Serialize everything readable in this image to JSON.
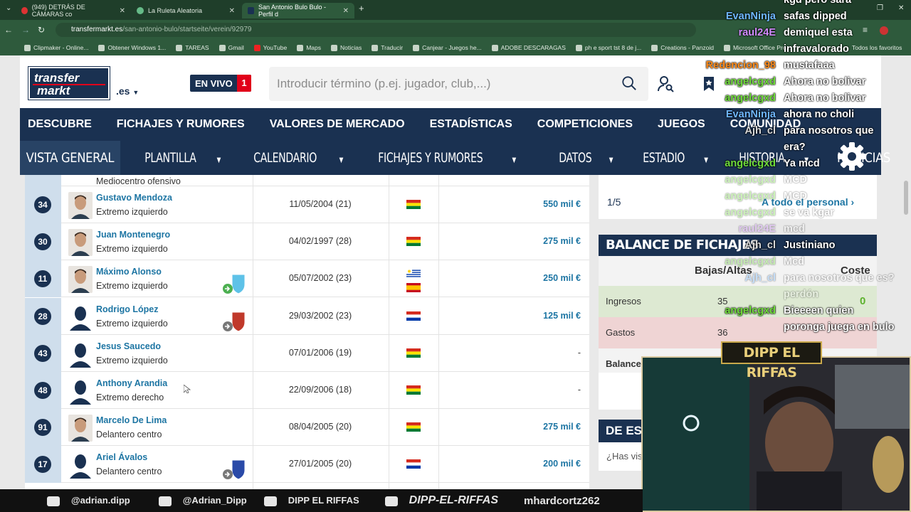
{
  "browser": {
    "tabs": [
      {
        "label": "(949) DETRÁS DE CÁMARAS co",
        "active": false
      },
      {
        "label": "La Ruleta Aleatoria",
        "active": false
      },
      {
        "label": "San Antonio Bulo Bulo - Perfil d",
        "active": true
      }
    ],
    "new_tab": "+",
    "url_host": "transfermarkt.es",
    "url_path": "/san-antonio-bulo/startseite/verein/92979",
    "bookmarks": [
      "Clipmaker - Online...",
      "Obtener Windows 1...",
      "TAREAS",
      "Gmail",
      "YouTube",
      "Maps",
      "Noticias",
      "Traducir",
      "Canjear - Juegos he...",
      "ADOBE DESCARAGAS",
      "ph e sport tst 8 de j...",
      "Creations - Panzoid",
      "Microsoft Office Pro..."
    ],
    "all_bookmarks": "Todos los favoritos"
  },
  "site": {
    "logo_top": "transfer",
    "logo_bottom": "markt",
    "domain": ".es",
    "live_label": "EN VIVO",
    "live_count": "1",
    "search_placeholder": "Introducir término (p.ej. jugador, club,...)",
    "main_nav": [
      "DESCUBRE",
      "FICHAJES Y RUMORES",
      "VALORES DE MERCADO",
      "ESTADÍSTICAS",
      "COMPETICIONES",
      "JUEGOS",
      "COMUNIDAD"
    ],
    "sub_nav": [
      "VISTA GENERAL",
      "PLANTILLA",
      "CALENDARIO",
      "FICHAJES Y RUMORES",
      "DATOS",
      "ESTADIO",
      "HISTORIA",
      "NOTICIAS"
    ]
  },
  "squad": {
    "partial_row_position": "Mediocentro ofensivo",
    "rows": [
      {
        "number": "34",
        "name": "Gustavo Mendoza",
        "position": "Extremo izquierdo",
        "dob": "11/05/2004 (21)",
        "flags": [
          "bol"
        ],
        "value": "550 mil €"
      },
      {
        "number": "30",
        "name": "Juan Montenegro",
        "position": "Extremo izquierdo",
        "dob": "04/02/1997 (28)",
        "flags": [
          "bol"
        ],
        "value": "275 mil €"
      },
      {
        "number": "11",
        "name": "Máximo Alonso",
        "position": "Extremo izquierdo",
        "dob": "05/07/2002 (23)",
        "flags": [
          "uru",
          "esp"
        ],
        "value": "250 mil €"
      },
      {
        "number": "28",
        "name": "Rodrigo López",
        "position": "Extremo izquierdo",
        "dob": "29/03/2002 (23)",
        "flags": [
          "par"
        ],
        "value": "125 mil €"
      },
      {
        "number": "43",
        "name": "Jesus Saucedo",
        "position": "Extremo izquierdo",
        "dob": "07/01/2006 (19)",
        "flags": [
          "bol"
        ],
        "value": "-"
      },
      {
        "number": "48",
        "name": "Anthony Arandia",
        "position": "Extremo derecho",
        "dob": "22/09/2006 (18)",
        "flags": [
          "bol"
        ],
        "value": "-"
      },
      {
        "number": "91",
        "name": "Marcelo De Lima",
        "position": "Delantero centro",
        "dob": "08/04/2005 (20)",
        "flags": [
          "bol"
        ],
        "value": "275 mil €"
      },
      {
        "number": "17",
        "name": "Ariel Ávalos",
        "position": "Delantero centro",
        "dob": "27/01/2005 (20)",
        "flags": [
          "par"
        ],
        "value": "200 mil €"
      }
    ]
  },
  "sidebar": {
    "pager": "1/5",
    "all_staff": "A todo el personal",
    "balance_title": "BALANCE DE FICHAJES",
    "col_bajas_altas": "Bajas/Altas",
    "col_coste": "Coste",
    "ingresos_label": "Ingresos",
    "ingresos_count": "35",
    "ingresos_cost": "0",
    "gastos_label": "Gastos",
    "gastos_count": "36",
    "balance_label": "Balance",
    "de_estadio_title": "DE ESTADIO",
    "has_visto": "¿Has visto"
  },
  "stream": {
    "cam_title": "DIPP EL RIFFAS",
    "chat": [
      {
        "user": "",
        "text": "kgd pero sara",
        "color": "#ffffff"
      },
      {
        "user": "EvanNinja",
        "text": "safas dipped",
        "color": "#6fb7ff"
      },
      {
        "user": "raul24E",
        "text": "demiquel esta",
        "color": "#d28cff"
      },
      {
        "user": "",
        "text": "infravalorado",
        "color": "#ffffff"
      },
      {
        "user": "Redencion_98",
        "text": "mustafaaa",
        "color": "#ff8c1a"
      },
      {
        "user": "angelcgxd",
        "text": "Ahora no bolivar",
        "color": "#6fdc3a"
      },
      {
        "user": "angelcgxd",
        "text": "Ahora no bolivar",
        "color": "#6fdc3a"
      },
      {
        "user": "EvanNinja",
        "text": "ahora no choli",
        "color": "#6fb7ff"
      },
      {
        "user": "Ajh_cl",
        "text": "para nosotros que",
        "color": "#d8d8d8"
      },
      {
        "user": "",
        "text": "era?",
        "color": "#ffffff"
      },
      {
        "user": "angelcgxd",
        "text": "Ya mcd",
        "color": "#6fdc3a"
      },
      {
        "user": "angelcgxd",
        "text": "MCD",
        "color": "#6fdc3a"
      },
      {
        "user": "angelcgxd",
        "text": "MCD",
        "color": "#6fdc3a"
      },
      {
        "user": "angelcgxd",
        "text": "se va kgar",
        "color": "#6fdc3a"
      },
      {
        "user": "raul24E",
        "text": "mcd",
        "color": "#d28cff"
      },
      {
        "user": "Ajh_cl",
        "text": "Justiniano",
        "color": "#d8d8d8"
      },
      {
        "user": "angelcgxd",
        "text": "Mcd",
        "color": "#6fdc3a"
      },
      {
        "user": "Ajh_cl",
        "text": "para nosotros que es?",
        "color": "#6fb7ff"
      },
      {
        "user": "",
        "text": "perdón",
        "color": "#ffffff"
      },
      {
        "user": "angelcgxd",
        "text": "Bieeeen quien",
        "color": "#6fdc3a"
      },
      {
        "user": "",
        "text": "poronga juega en bulo",
        "color": "#ffffff"
      }
    ],
    "socials": [
      "@adrian.dipp",
      "@Adrian_Dipp",
      "DIPP EL RIFFAS",
      "DIPP-EL-RIFFAS",
      "mhardcortz262"
    ]
  }
}
